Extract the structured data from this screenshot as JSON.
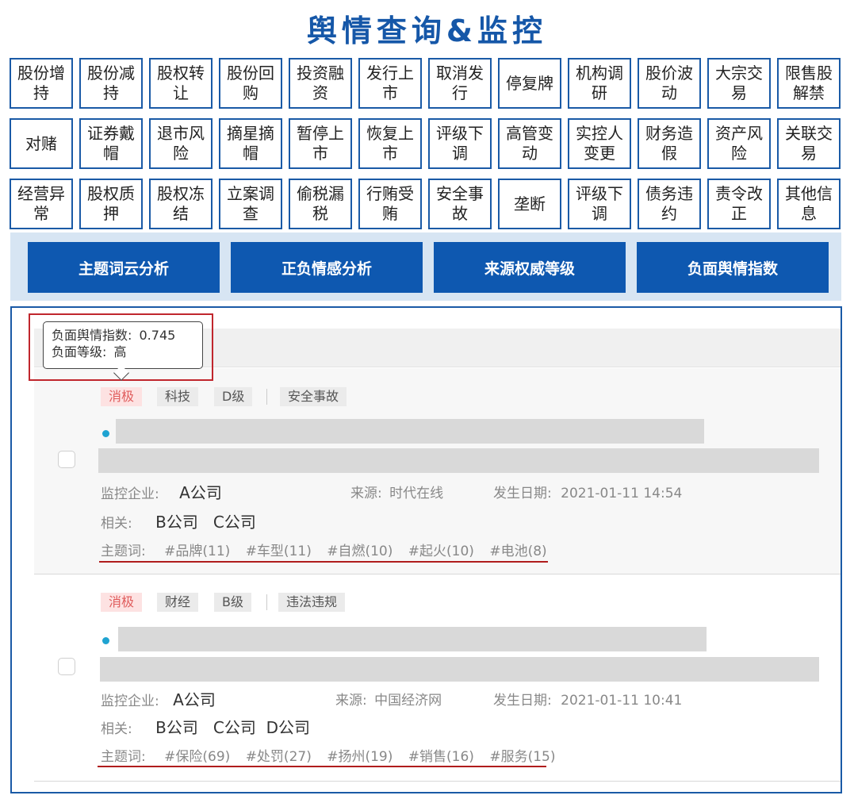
{
  "header": {
    "title": "舆情查询&监控"
  },
  "event_tags": [
    [
      "股份增持",
      "股份减持",
      "股权转让",
      "股份回购",
      "投资融资",
      "发行上市",
      "取消发行",
      "停复牌",
      "机构调研",
      "股价波动",
      "大宗交易",
      "限售股解禁"
    ],
    [
      "对赌",
      "证券戴帽",
      "退市风险",
      "摘星摘帽",
      "暂停上市",
      "恢复上市",
      "评级下调",
      "高管变动",
      "实控人变更",
      "财务造假",
      "资产风险",
      "关联交易"
    ],
    [
      "经营异常",
      "股权质押",
      "股权冻结",
      "立案调查",
      "偷税漏税",
      "行贿受贿",
      "安全事故",
      "垄断",
      "评级下调",
      "债务违约",
      "责令改正",
      "其他信息"
    ]
  ],
  "analysis_buttons": [
    "主题词云分析",
    "正负情感分析",
    "来源权威等级",
    "负面舆情指数"
  ],
  "tooltip": {
    "index_label": "负面舆情指数:",
    "index_value": "0.745",
    "level_label": "负面等级:",
    "level_value": "高"
  },
  "news": [
    {
      "sentiment": "消极",
      "industry": "科技",
      "grade": "D级",
      "category": "安全事故",
      "labels": {
        "monitor": "监控企业:",
        "source": "来源:",
        "date": "发生日期:",
        "related": "相关:",
        "keywords": "主题词:"
      },
      "monitor_company": "A公司",
      "source": "时代在线",
      "date": "2021-01-11 14:54",
      "related": "B公司   C公司",
      "keywords": [
        "#品牌(11)",
        "#车型(11)",
        "#自燃(10)",
        "#起火(10)",
        "#电池(8)"
      ]
    },
    {
      "sentiment": "消极",
      "industry": "财经",
      "grade": "B级",
      "category": "违法违规",
      "labels": {
        "monitor": "监控企业:",
        "source": "来源:",
        "date": "发生日期:",
        "related": "相关:",
        "keywords": "主题词:"
      },
      "monitor_company": "A公司",
      "source": "中国经济网",
      "date": "2021-01-11 10:41",
      "related": "B公司   C公司  D公司",
      "keywords": [
        "#保险(69)",
        "#处罚(27)",
        "#扬州(19)",
        "#销售(16)",
        "#服务(15)"
      ]
    }
  ],
  "colors": {
    "brand": "#1557a8",
    "button": "#0e58b0",
    "panel": "#d7e5f3",
    "negative": "#e05c5c",
    "highlight": "#c0262d",
    "dot": "#1fa3d1"
  }
}
